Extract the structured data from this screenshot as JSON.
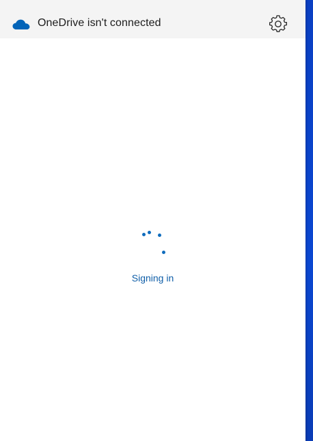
{
  "header": {
    "title": "OneDrive isn't connected",
    "cloud_icon": "onedrive-cloud-icon",
    "settings_icon": "gear-icon"
  },
  "main": {
    "status_text": "Signing in",
    "spinner_icon": "loading-spinner-icon"
  },
  "colors": {
    "accent": "#0f6cbd",
    "cloud": "#0364b8",
    "header_bg": "#f4f4f4",
    "desktop_bg": "#0b47d1"
  }
}
